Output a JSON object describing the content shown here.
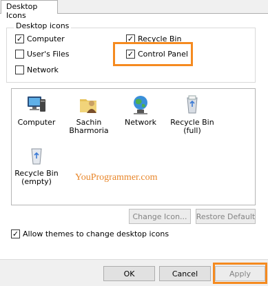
{
  "tab": {
    "label": "Desktop Icons"
  },
  "group": {
    "label": "Desktop icons",
    "checkboxes": [
      {
        "label": "Computer",
        "checked": true
      },
      {
        "label": "User's Files",
        "checked": false
      },
      {
        "label": "Network",
        "checked": false
      },
      {
        "label": "Recycle Bin",
        "checked": true
      },
      {
        "label": "Control Panel",
        "checked": true
      }
    ]
  },
  "icons": [
    {
      "label": "Computer",
      "icon": "computer-icon"
    },
    {
      "label": "Sachin Bharmoria",
      "icon": "user-folder-icon"
    },
    {
      "label": "Network",
      "icon": "network-icon"
    },
    {
      "label": "Recycle Bin (full)",
      "icon": "recycle-bin-full-icon"
    },
    {
      "label": "Recycle Bin (empty)",
      "icon": "recycle-bin-empty-icon"
    }
  ],
  "watermark": "YouProgrammer.com",
  "buttons": {
    "change_icon": "Change Icon...",
    "restore_default": "Restore Default",
    "ok": "OK",
    "cancel": "Cancel",
    "apply": "Apply"
  },
  "themes": {
    "label": "Allow themes to change desktop icons",
    "checked": true
  },
  "colors": {
    "highlight": "#f58a1f",
    "watermark": "#e8862a"
  }
}
